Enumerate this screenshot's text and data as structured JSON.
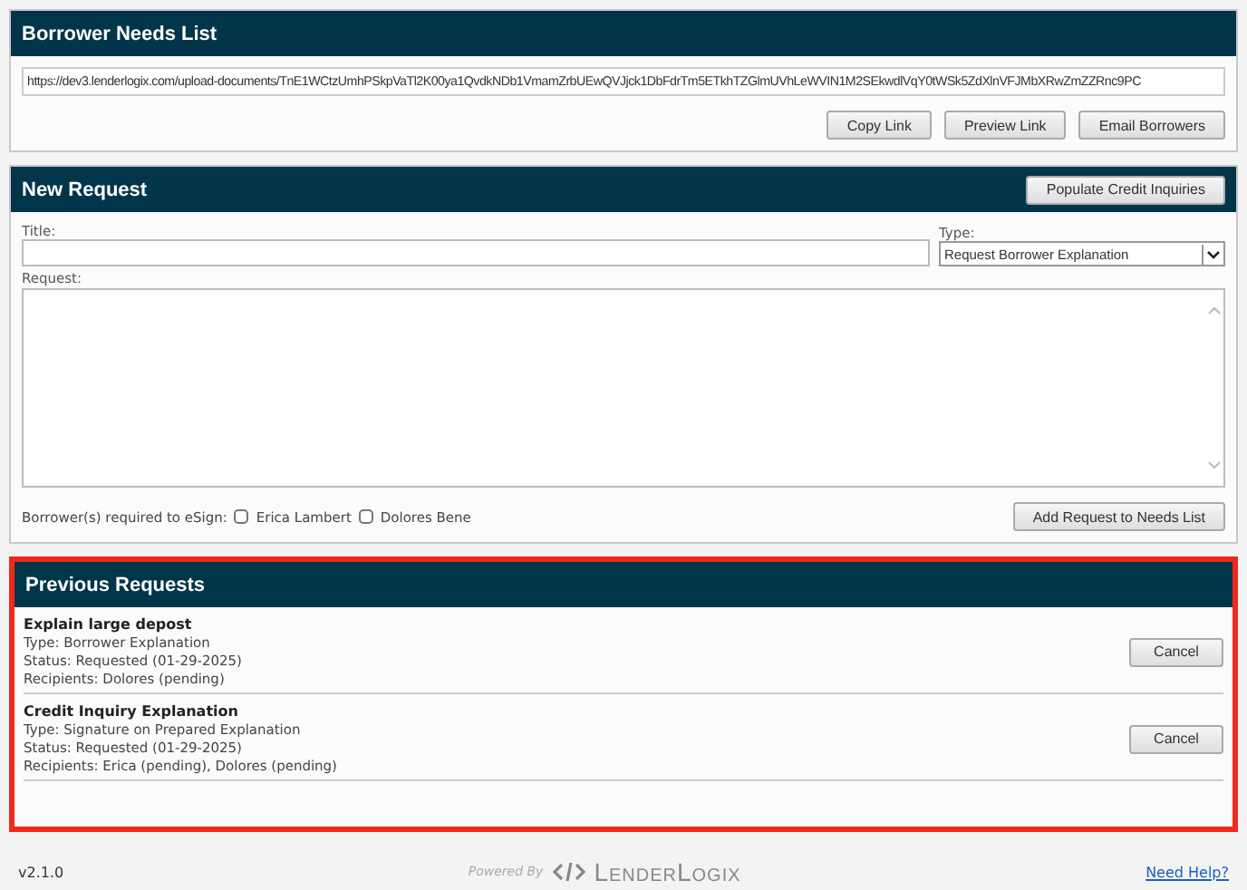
{
  "needs_list": {
    "title": "Borrower Needs List",
    "link": "https://dev3.lenderlogix.com/upload-documents/TnE1WCtzUmhPSkpVaTl2K00ya1QvdkNDb1VmamZrbUEwQVJjck1DbFdrTm5ETkhTZGlmUVhLeWVIN1M2SEkwdlVqY0tWSk5ZdXlnVFJMbXRwZmZZRnc9PC",
    "buttons": [
      "Copy Link",
      "Preview Link",
      "Email Borrowers"
    ]
  },
  "new_request": {
    "title": "New Request",
    "header_button": "Populate Credit Inquiries",
    "title_label": "Title:",
    "type_label": "Type:",
    "type_value": "Request Borrower Explanation",
    "request_label": "Request:",
    "esign_label": "Borrower(s) required to eSign:",
    "borrowers": [
      {
        "name": "Erica Lambert",
        "checked": false
      },
      {
        "name": "Dolores Bene",
        "checked": false
      }
    ],
    "submit": "Add Request to Needs List"
  },
  "previous_requests": {
    "title": "Previous Requests",
    "highlighted": true,
    "items": [
      {
        "title": "Explain large depost",
        "lines": [
          "Type: Borrower Explanation",
          "Status: Requested (01-29-2025)",
          "Recipients: Dolores (pending)"
        ],
        "action": "Cancel"
      },
      {
        "title": "Credit Inquiry Explanation",
        "lines": [
          "Type: Signature on Prepared Explanation",
          "Status: Requested (01-29-2025)",
          "Recipients: Erica (pending), Dolores (pending)"
        ],
        "action": "Cancel"
      }
    ]
  },
  "footer": {
    "version": "v2.1.0",
    "powered_by": "Powered By",
    "brand": "LenderLogix",
    "help": "Need Help?"
  }
}
